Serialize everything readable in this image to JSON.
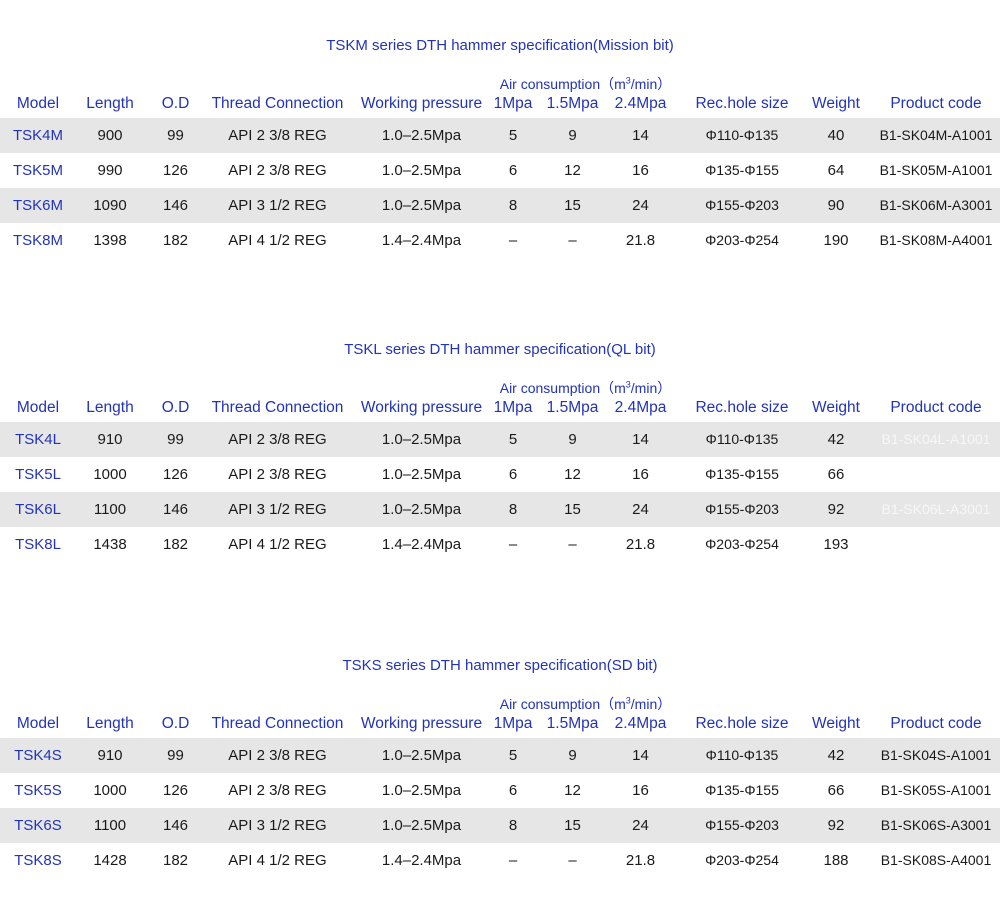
{
  "headers": {
    "model": "Model",
    "length": "Length",
    "od": "O.D",
    "thread": "Thread Connection",
    "pressure": "Working pressure",
    "air_prefix": "Air consumption（m",
    "air_sup": "3",
    "air_suffix": "/min）",
    "air_1": "1Mpa",
    "air_15": "1.5Mpa",
    "air_24": "2.4Mpa",
    "hole": "Rec.hole size",
    "weight": "Weight",
    "code": "Product code"
  },
  "sections": [
    {
      "title": "TSKM series DTH hammer specification(Mission bit)",
      "rows": [
        {
          "model": "TSK4M",
          "length": "900",
          "od": "99",
          "thread": "API 2 3/8 REG",
          "pressure": "1.0–2.5Mpa",
          "air1": "5",
          "air15": "9",
          "air24": "14",
          "hole": "Φ110-Φ135",
          "weight": "40",
          "code": "B1-SK04M-A1001"
        },
        {
          "model": "TSK5M",
          "length": "990",
          "od": "126",
          "thread": "API 2 3/8 REG",
          "pressure": "1.0–2.5Mpa",
          "air1": "6",
          "air15": "12",
          "air24": "16",
          "hole": "Φ135-Φ155",
          "weight": "64",
          "code": "B1-SK05M-A1001"
        },
        {
          "model": "TSK6M",
          "length": "1090",
          "od": "146",
          "thread": "API 3 1/2 REG",
          "pressure": "1.0–2.5Mpa",
          "air1": "8",
          "air15": "15",
          "air24": "24",
          "hole": "Φ155-Φ203",
          "weight": "90",
          "code": "B1-SK06M-A3001"
        },
        {
          "model": "TSK8M",
          "length": "1398",
          "od": "182",
          "thread": "API 4 1/2 REG",
          "pressure": "1.4–2.4Mpa",
          "air1": "–",
          "air15": "–",
          "air24": "21.8",
          "hole": "Φ203-Φ254",
          "weight": "190",
          "code": "B1-SK08M-A4001"
        }
      ]
    },
    {
      "title": "TSKL series DTH hammer specification(QL bit)",
      "rows": [
        {
          "model": "TSK4L",
          "length": "910",
          "od": "99",
          "thread": "API 2 3/8 REG",
          "pressure": "1.0–2.5Mpa",
          "air1": "5",
          "air15": "9",
          "air24": "14",
          "hole": "Φ110-Φ135",
          "weight": "42",
          "code": "B1-SK04L-A1001"
        },
        {
          "model": "TSK5L",
          "length": "1000",
          "od": "126",
          "thread": "API 2 3/8 REG",
          "pressure": "1.0–2.5Mpa",
          "air1": "6",
          "air15": "12",
          "air24": "16",
          "hole": "Φ135-Φ155",
          "weight": "66",
          "code": ""
        },
        {
          "model": "TSK6L",
          "length": "1100",
          "od": "146",
          "thread": "API 3 1/2 REG",
          "pressure": "1.0–2.5Mpa",
          "air1": "8",
          "air15": "15",
          "air24": "24",
          "hole": "Φ155-Φ203",
          "weight": "92",
          "code": "B1-SK06L-A3001"
        },
        {
          "model": "TSK8L",
          "length": "1438",
          "od": "182",
          "thread": "API 4 1/2 REG",
          "pressure": "1.4–2.4Mpa",
          "air1": "–",
          "air15": "–",
          "air24": "21.8",
          "hole": "Φ203-Φ254",
          "weight": "193",
          "code": ""
        }
      ]
    },
    {
      "title": "TSKS series DTH hammer specification(SD bit)",
      "rows": [
        {
          "model": "TSK4S",
          "length": "910",
          "od": "99",
          "thread": "API 2 3/8 REG",
          "pressure": "1.0–2.5Mpa",
          "air1": "5",
          "air15": "9",
          "air24": "14",
          "hole": "Φ110-Φ135",
          "weight": "42",
          "code": "B1-SK04S-A1001"
        },
        {
          "model": "TSK5S",
          "length": "1000",
          "od": "126",
          "thread": "API 2 3/8 REG",
          "pressure": "1.0–2.5Mpa",
          "air1": "6",
          "air15": "12",
          "air24": "16",
          "hole": "Φ135-Φ155",
          "weight": "66",
          "code": "B1-SK05S-A1001"
        },
        {
          "model": "TSK6S",
          "length": "1100",
          "od": "146",
          "thread": "API 3 1/2 REG",
          "pressure": "1.0–2.5Mpa",
          "air1": "8",
          "air15": "15",
          "air24": "24",
          "hole": "Φ155-Φ203",
          "weight": "92",
          "code": "B1-SK06S-A3001"
        },
        {
          "model": "TSK8S",
          "length": "1428",
          "od": "182",
          "thread": "API 4 1/2 REG",
          "pressure": "1.4–2.4Mpa",
          "air1": "–",
          "air15": "–",
          "air24": "21.8",
          "hole": "Φ203-Φ254",
          "weight": "188",
          "code": "B1-SK08S-A4001"
        }
      ]
    }
  ]
}
